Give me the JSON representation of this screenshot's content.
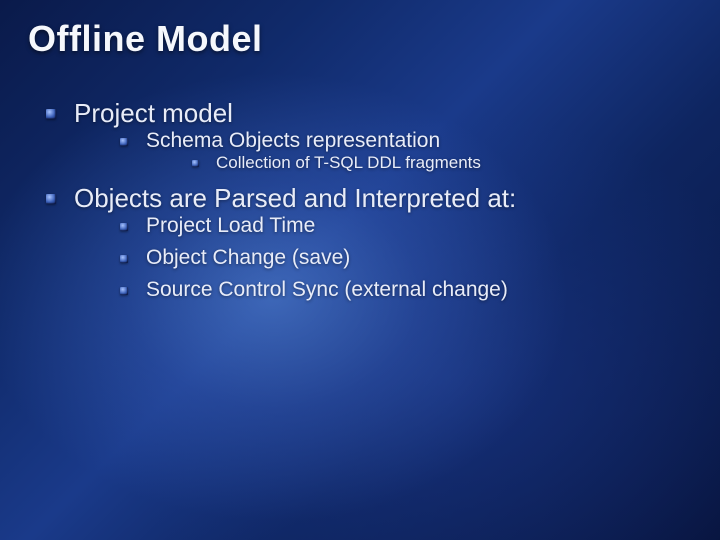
{
  "title": "Offline Model",
  "bullets": {
    "l1a": "Project model",
    "l2a": "Schema Objects representation",
    "l3a": "Collection of T-SQL DDL fragments",
    "l1b": "Objects are Parsed and Interpreted at:",
    "l2b": "Project Load Time",
    "l2c": "Object Change (save)",
    "l2d": "Source Control Sync (external change)"
  }
}
